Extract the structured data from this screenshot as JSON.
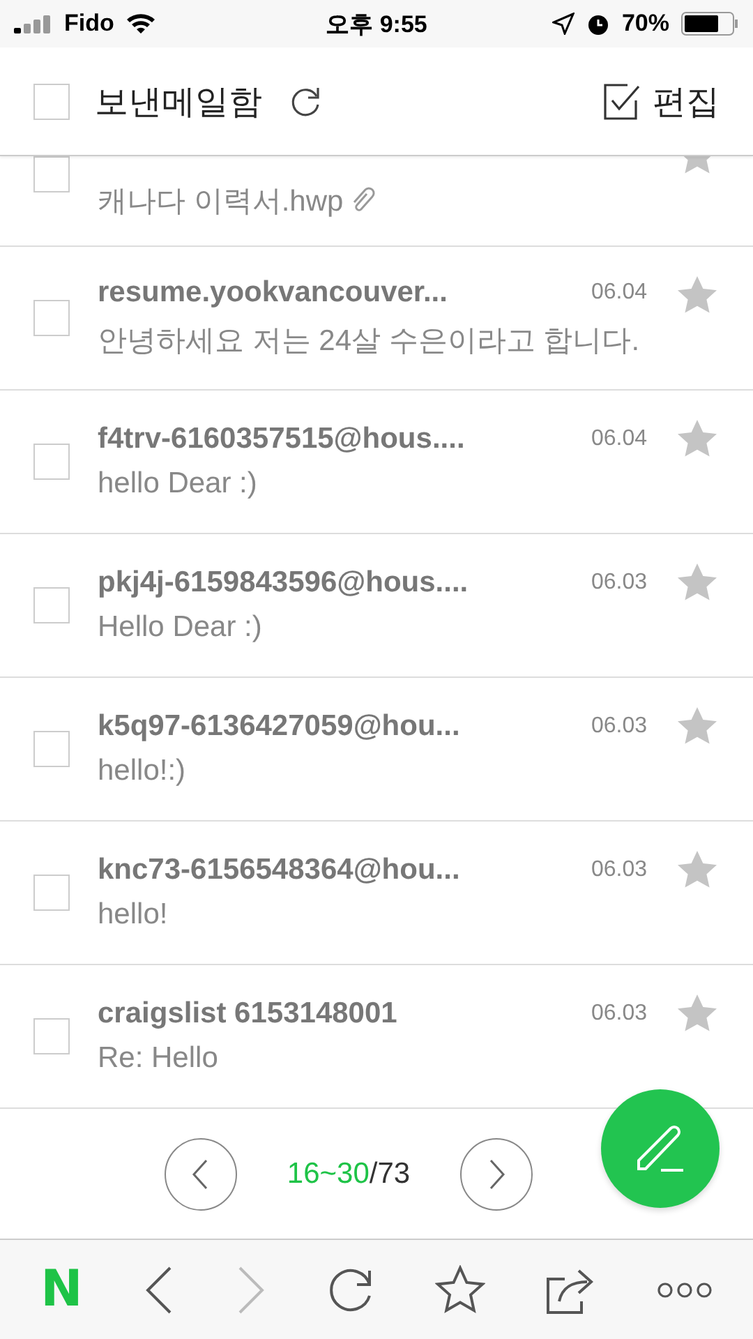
{
  "status_bar": {
    "carrier": "Fido",
    "time": "오후 9:55",
    "battery": "70%"
  },
  "header": {
    "title": "보낸메일함",
    "edit": "편집",
    "all_checked": false
  },
  "mails": [
    {
      "kind": "partial",
      "subject": "캐나다 이력서.hwp",
      "attachment": true,
      "checked": false,
      "starred": false
    },
    {
      "kind": "full",
      "sender": "resume.yookvancouver...",
      "date": "06.04",
      "subject": "안녕하세요 저는 24살 수은이라고 합니다.",
      "attachment": false,
      "checked": false,
      "starred": false
    },
    {
      "kind": "full",
      "sender": "f4trv-6160357515@hous....",
      "date": "06.04",
      "subject": "hello Dear :)",
      "attachment": false,
      "checked": false,
      "starred": false
    },
    {
      "kind": "full",
      "sender": "pkj4j-6159843596@hous....",
      "date": "06.03",
      "subject": "Hello Dear :)",
      "attachment": false,
      "checked": false,
      "starred": false
    },
    {
      "kind": "full",
      "sender": "k5q97-6136427059@hou...",
      "date": "06.03",
      "subject": "hello!:)",
      "attachment": false,
      "checked": false,
      "starred": false
    },
    {
      "kind": "full",
      "sender": "knc73-6156548364@hou...",
      "date": "06.03",
      "subject": "hello!",
      "attachment": false,
      "checked": false,
      "starred": false
    },
    {
      "kind": "full",
      "sender": "craigslist 6153148001",
      "date": "06.03",
      "subject": "Re: Hello",
      "attachment": false,
      "checked": false,
      "starred": false
    }
  ],
  "pager": {
    "range": "16~30",
    "total": "/73"
  },
  "toolbar": {
    "logo": "N",
    "forward_disabled": true
  }
}
